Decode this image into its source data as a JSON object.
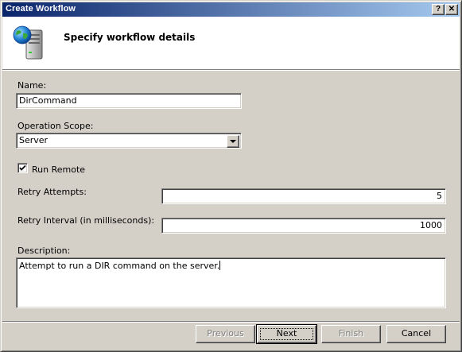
{
  "window": {
    "title": "Create Workflow",
    "help_glyph": "?",
    "close_glyph": "✕"
  },
  "header": {
    "title": "Specify workflow details",
    "icon": "globe-server-icon"
  },
  "form": {
    "name_label": "Name:",
    "name_value": "DirCommand",
    "scope_label": "Operation Scope:",
    "scope_value": "Server",
    "run_remote_label": "Run Remote",
    "run_remote_checked": true,
    "retry_attempts_label": "Retry Attempts:",
    "retry_attempts_value": "5",
    "retry_interval_label": "Retry Interval (in milliseconds):",
    "retry_interval_value": "1000",
    "description_label": "Description:",
    "description_value": "Attempt to run a DIR command on the server."
  },
  "buttons": {
    "previous": "Previous",
    "next": "Next",
    "finish": "Finish",
    "cancel": "Cancel"
  },
  "colors": {
    "titlebar_start": "#0a246a",
    "titlebar_end": "#a6caf0",
    "face": "#d4d0c8"
  }
}
